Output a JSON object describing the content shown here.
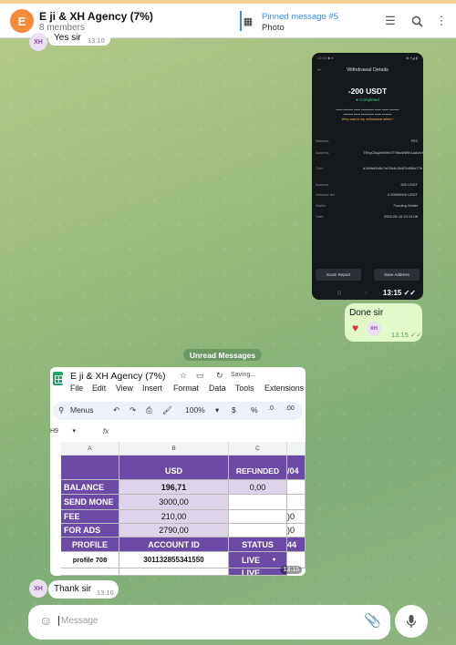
{
  "header": {
    "avatar_letter": "E",
    "title": "E ji & XH Agency (7%)",
    "members": "8 members",
    "pinned_title": "Pinned message #5",
    "pinned_sub": "Photo"
  },
  "messages": {
    "yes": {
      "text": "Yes sir",
      "time": "13:10"
    },
    "done": {
      "text": "Done sir",
      "time": "13:15"
    },
    "photo1_time": "13:15",
    "unread": "Unread Messages",
    "photo2_time": "13:15",
    "thank": {
      "text": "Thank sir",
      "time": "13:16"
    },
    "avatar_text": "XH"
  },
  "phone": {
    "title": "Withdrawal Details",
    "amount": "-200 USDT",
    "status": "Completed",
    "link": "Why was'nt my withdrawal fallen?",
    "rows": [
      {
        "k": "Network",
        "v": "TRX"
      },
      {
        "k": "Address",
        "v": "TRxyC6q2e99Hx7TH6v6NRh1aaVsYrK3tt"
      },
      {
        "k": "Txid",
        "v": "a1fd9ef4b8c7e02d4c3b4f7b896e77e"
      },
      {
        "k": "Amount",
        "v": "200 USDT"
      },
      {
        "k": "Network fee",
        "v": "0.00000000 USDT"
      },
      {
        "k": "Wallet",
        "v": "Funding Wallet"
      },
      {
        "k": "Date",
        "v": "2025-05-16 10:14:08"
      }
    ],
    "btn_left": "Scam Report",
    "btn_right": "Save Address"
  },
  "sheet": {
    "title": "E ji & XH Agency (7%)",
    "saving": "Saving...",
    "menus": [
      "File",
      "Edit",
      "View",
      "Insert",
      "Format",
      "Data",
      "Tools",
      "Extensions"
    ],
    "toolbar_menus": "Menus",
    "zoom": "100%",
    "cellref": "H9",
    "cols": [
      "A",
      "B",
      "C"
    ],
    "usd": "USD",
    "refunded": "REFUNDED",
    "partial": "/04",
    "rows": [
      {
        "label": "BALANCE",
        "value": "196,71",
        "c": "0,00",
        "d": ""
      },
      {
        "label": "SEND MONE",
        "value": "3000,00",
        "c": "",
        "d": ""
      },
      {
        "label": "FEE",
        "value": "210,00",
        "c": "",
        "d": ")0"
      },
      {
        "label": "FOR ADS",
        "value": "2790,00",
        "c": "",
        "d": ")0"
      }
    ],
    "hdr2": [
      "PROFILE",
      "ACCOUNT ID",
      "STATUS",
      "44"
    ],
    "data": [
      {
        "profile": "profile 708",
        "account": "301132855341550",
        "status": "LIVE"
      }
    ],
    "status2": "LIVE"
  },
  "composer": {
    "placeholder": "Message"
  }
}
